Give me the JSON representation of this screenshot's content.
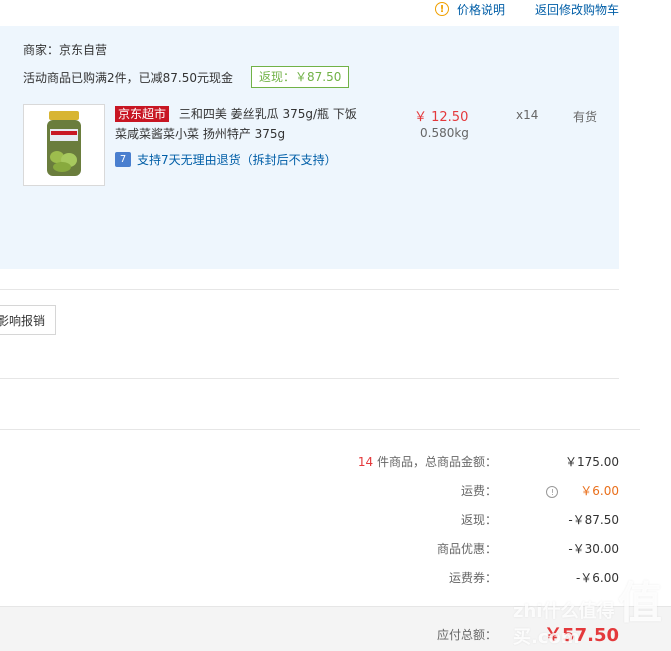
{
  "top_links": {
    "price_info": "价格说明",
    "back_to_cart": "返回修改购物车"
  },
  "order": {
    "seller": "商家：京东自营",
    "promo": "活动商品已购满2件，已减87.50元现金",
    "rebate_badge": "返现：￥87.50",
    "item": {
      "tag": "京东超市",
      "title": "三和四美 姜丝乳瓜 375g/瓶 下饭菜咸菜酱菜小菜 扬州特产 375g",
      "return_policy": "支持7天无理由退货（拆封后不支持）",
      "price": "￥ 12.50",
      "weight": "0.580kg",
      "quantity": "x14",
      "stock": "有货"
    }
  },
  "left_button": {
    "label": "影响报销"
  },
  "summary": {
    "items_total": {
      "count": "14",
      "label": "件商品，总商品金额：",
      "value": "￥175.00"
    },
    "shipping": {
      "label": "运费：",
      "value": "￥6.00"
    },
    "cashback": {
      "label": "返现：",
      "value": "-￥87.50"
    },
    "discount": {
      "label": "商品优惠：",
      "value": "-￥30.00"
    },
    "shipping_coupon": {
      "label": "运费券：",
      "value": "-￥6.00"
    },
    "payable": {
      "label": "应付总额：",
      "value": "￥57.50"
    }
  },
  "watermark": {
    "main": "值",
    "sub": "zhi什么值得买.com"
  },
  "colors": {
    "accent_red": "#e4393c",
    "link_blue": "#005ea7",
    "promo_green": "#71b247",
    "panel_blue": "#eef6fd"
  }
}
